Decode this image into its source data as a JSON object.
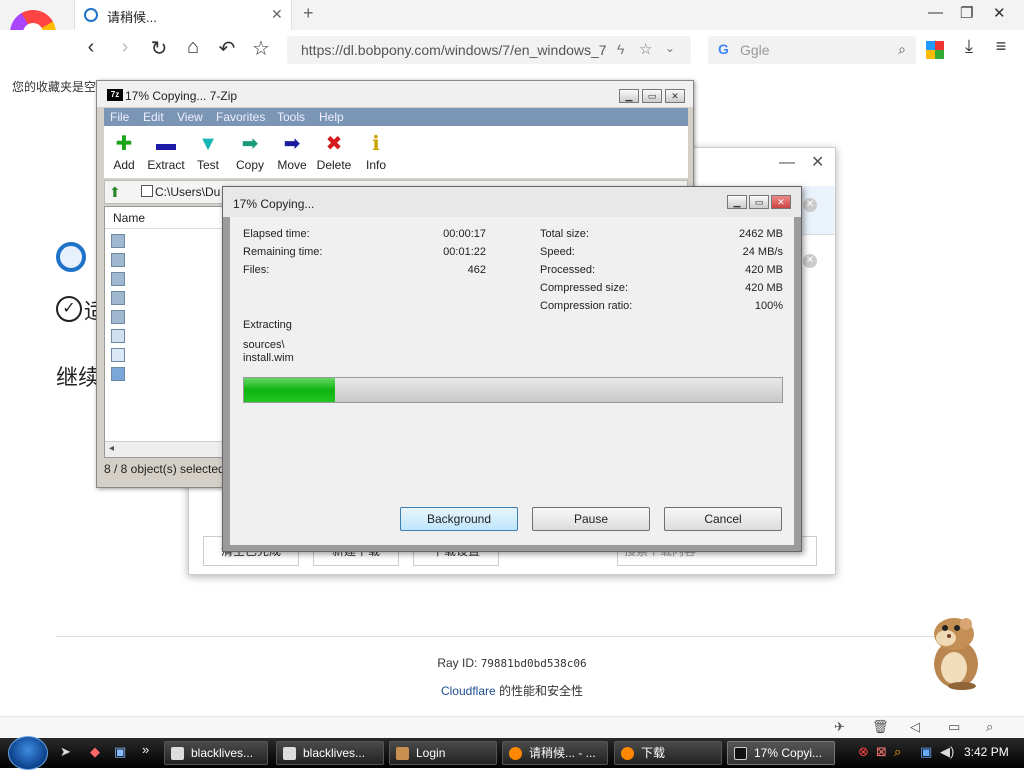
{
  "browser": {
    "tab_title": "请稍候...",
    "tab_close": "✕",
    "new_tab": "+",
    "url": "https://dl.bobpony.com/windows/7/en_windows_7",
    "search_placeholder": "Ggle",
    "bookmarks_bar_text": "您的收藏夹是空",
    "window_controls": [
      "—",
      "❐",
      "✕"
    ]
  },
  "page": {
    "char1": "适",
    "char2": "继续",
    "ray_label": "Ray ID:",
    "ray_id": "79881bd0bd538c06",
    "cloudflare": "Cloudflare",
    "cloudflare_suffix": " 的性能和安全性"
  },
  "download_manager": {
    "button1": "清空已完成",
    "button2": "新建下载",
    "button3": "下载设置",
    "search_placeholder": "搜索下载内容"
  },
  "zip_window": {
    "title": "17% Copying... 7-Zip",
    "menu": [
      "File",
      "Edit",
      "View",
      "Favorites",
      "Tools",
      "Help"
    ],
    "toolbar": [
      {
        "label": "Add",
        "icon": "plus-icon",
        "color": "#1aa41a"
      },
      {
        "label": "Extract",
        "icon": "minus-icon",
        "color": "#1c1ca8"
      },
      {
        "label": "Test",
        "icon": "check-icon",
        "color": "#19b5b5"
      },
      {
        "label": "Copy",
        "icon": "arrow-icon",
        "color": "#1a9a7a"
      },
      {
        "label": "Move",
        "icon": "arrow-icon",
        "color": "#1c1c9a"
      },
      {
        "label": "Delete",
        "icon": "x-icon",
        "color": "#d41a1a"
      },
      {
        "label": "Info",
        "icon": "info-icon",
        "color": "#c9a400"
      }
    ],
    "path": "C:\\Users\\Du",
    "column_name": "Name",
    "status": "8 / 8 object(s) selected"
  },
  "progress": {
    "title": "17% Copying...",
    "elapsed_label": "Elapsed time:",
    "elapsed_value": "00:00:17",
    "remaining_label": "Remaining time:",
    "remaining_value": "00:01:22",
    "files_label": "Files:",
    "files_value": "462",
    "total_label": "Total size:",
    "total_value": "2462 MB",
    "speed_label": "Speed:",
    "speed_value": "24 MB/s",
    "processed_label": "Processed:",
    "processed_value": "420 MB",
    "compressed_label": "Compressed size:",
    "compressed_value": "420 MB",
    "ratio_label": "Compression ratio:",
    "ratio_value": "100%",
    "operation": "Extracting",
    "path_line1": "sources\\",
    "path_line2": "install.wim",
    "percent": 17,
    "btn_background": "Background",
    "btn_pause": "Pause",
    "btn_cancel": "Cancel"
  },
  "taskbar": {
    "items": [
      "blacklives...",
      "blacklives...",
      "Login",
      "请稍候... - ...",
      "下载",
      "17% Copyi..."
    ],
    "time": "3:42 PM"
  }
}
